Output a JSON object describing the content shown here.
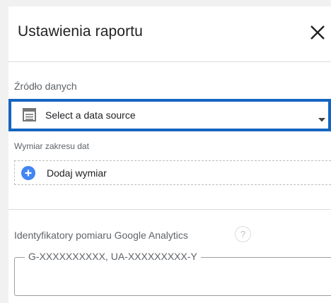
{
  "panel": {
    "title": "Ustawienia raportu",
    "close_icon": "close-icon"
  },
  "data_source": {
    "label": "Źródło danych",
    "selected": "Select a data source",
    "icon": "datasource-table-icon",
    "highlight_color": "#1565c0"
  },
  "date_dimension": {
    "label": "Wymiar zakresu dat",
    "add_label": "Dodaj wymiar",
    "icon": "plus-circle-icon",
    "icon_color": "#4285f4"
  },
  "analytics": {
    "label": "Identyfikatory pomiaru Google Analytics",
    "help": "?",
    "placeholder": "G-XXXXXXXXXX, UA-XXXXXXXXX-Y"
  }
}
